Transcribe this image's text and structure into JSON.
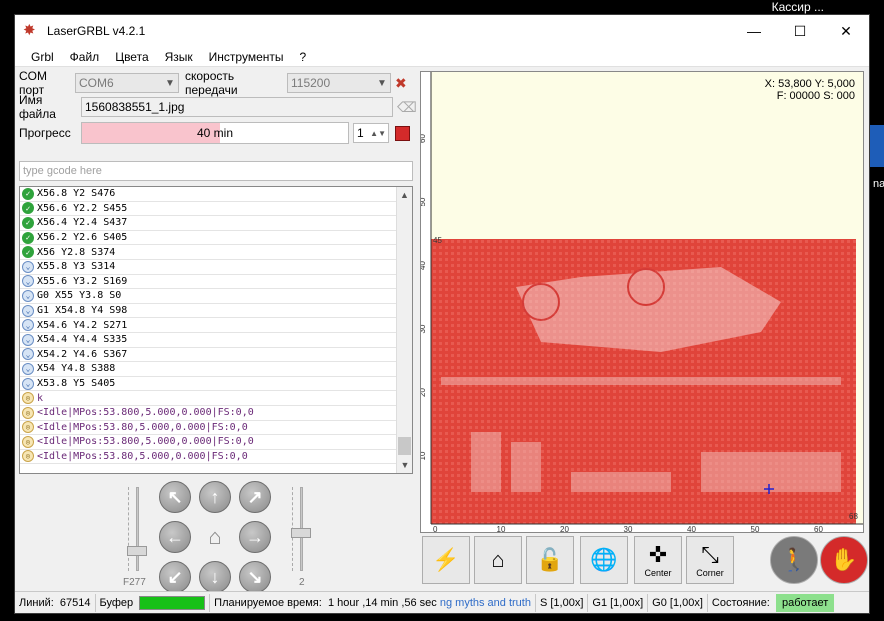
{
  "desktop": {
    "top_text": "Кассир ...",
    "icon_label": "na"
  },
  "window": {
    "title": "LaserGRBL v4.2.1",
    "controls": [
      "—",
      "☐",
      "✕"
    ]
  },
  "menu": [
    "Grbl",
    "Файл",
    "Цвета",
    "Язык",
    "Инструменты",
    "?"
  ],
  "conn": {
    "com_label": "COM порт",
    "com_value": "COM6",
    "baud_label": "скорость передачи",
    "baud_value": "115200"
  },
  "file": {
    "label": "Имя файла",
    "value": "1560838551_1.jpg"
  },
  "progress": {
    "label": "Прогресс",
    "text": "40 min",
    "fraction": 0.52,
    "count": "1"
  },
  "gcode_input": {
    "placeholder": "type gcode here"
  },
  "log": [
    {
      "status": "ok",
      "text": "X56.8 Y2 S476"
    },
    {
      "status": "ok",
      "text": "X56.6 Y2.2 S455"
    },
    {
      "status": "ok",
      "text": "X56.4 Y2.4 S437"
    },
    {
      "status": "ok",
      "text": "X56.2 Y2.6 S405"
    },
    {
      "status": "ok",
      "text": "X56 Y2.8 S374"
    },
    {
      "status": "pending",
      "text": "X55.8 Y3 S314"
    },
    {
      "status": "pending",
      "text": "X55.6 Y3.2 S169"
    },
    {
      "status": "pending",
      "text": "G0 X55 Y3.8 S0"
    },
    {
      "status": "pending",
      "text": "G1 X54.8 Y4 S98"
    },
    {
      "status": "pending",
      "text": "X54.6 Y4.2 S271"
    },
    {
      "status": "pending",
      "text": "X54.4 Y4.4 S335"
    },
    {
      "status": "pending",
      "text": "X54.2 Y4.6 S367"
    },
    {
      "status": "pending",
      "text": "X54 Y4.8 S388"
    },
    {
      "status": "pending",
      "text": "X53.8 Y5 S405"
    },
    {
      "status": "response",
      "text": "k"
    },
    {
      "status": "response",
      "text": "<Idle|MPos:53.800,5.000,0.000|FS:0,0"
    },
    {
      "status": "response",
      "text": "<Idle|MPos:53.80,5.000,0.000|FS:0,0"
    },
    {
      "status": "response",
      "text": "<Idle|MPos:53.800,5.000,0.000|FS:0,0"
    },
    {
      "status": "response",
      "text": "<Idle|MPos:53.80,5.000,0.000|FS:0,0"
    }
  ],
  "jog": {
    "speed_label": "F277",
    "step_label": "2",
    "speed_level": 0.8,
    "step_level": 0.55
  },
  "preview": {
    "coords_line1": "X: 53,800 Y: 5,000",
    "coords_line2": "F: 00000 S: 000",
    "x_ticks": [
      "0",
      "10",
      "20",
      "30",
      "40",
      "50",
      "60"
    ],
    "y_ticks": [
      "10",
      "20",
      "30",
      "40",
      "50",
      "60"
    ],
    "marker_top": "45",
    "marker_right": "68",
    "image_color": "#e0443a",
    "bg_color": "#fdfde6"
  },
  "toolbar": [
    {
      "name": "connect-button",
      "icon": "⚡",
      "label": ""
    },
    {
      "name": "home-button",
      "icon": "⌂",
      "label": ""
    },
    {
      "name": "unlock-button",
      "icon": "🔓",
      "label": ""
    },
    {
      "name": "globe-button",
      "icon": "🌐",
      "label": ""
    },
    {
      "name": "center-button",
      "icon": "✜",
      "label": "Center"
    },
    {
      "name": "corner-button",
      "icon": "⤡",
      "label": "Corner"
    },
    {
      "name": "walk-button",
      "icon": "🚶",
      "label": ""
    },
    {
      "name": "stop-button",
      "icon": "✋",
      "label": ""
    }
  ],
  "status": {
    "lines_label": "Линий:",
    "lines_value": "67514",
    "buffer_label": "Буфер",
    "est_label": "Планируемое время:",
    "est_value": "1 hour ,14 min ,56 sec",
    "link": "ng myths and truth",
    "s": "S [1,00x]",
    "g1": "G1 [1,00x]",
    "g0": "G0 [1,00x]",
    "state_label": "Состояние:",
    "state_value": "работает"
  }
}
